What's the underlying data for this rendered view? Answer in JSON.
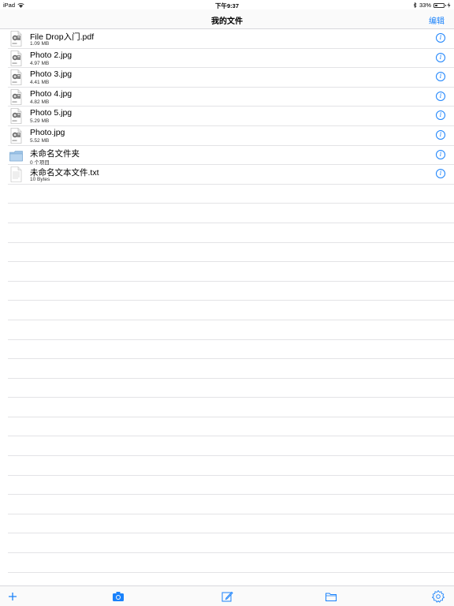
{
  "status_bar": {
    "device": "iPad",
    "time": "下午9:37",
    "battery_percent": "33%",
    "battery_level": 0.33
  },
  "nav": {
    "title": "我的文件",
    "edit_label": "编辑"
  },
  "files": [
    {
      "name": "File Drop入门.pdf",
      "detail": "1.09 MB",
      "kind": "pdf"
    },
    {
      "name": "Photo 2.jpg",
      "detail": "4.97 MB",
      "kind": "jpeg"
    },
    {
      "name": "Photo 3.jpg",
      "detail": "4.41 MB",
      "kind": "jpeg"
    },
    {
      "name": "Photo 4.jpg",
      "detail": "4.82 MB",
      "kind": "jpeg"
    },
    {
      "name": "Photo 5.jpg",
      "detail": "5.29 MB",
      "kind": "jpeg"
    },
    {
      "name": "Photo.jpg",
      "detail": "5.52 MB",
      "kind": "jpeg"
    },
    {
      "name": "未命名文件夹",
      "detail": "0 个项目",
      "kind": "folder"
    },
    {
      "name": "未命名文本文件.txt",
      "detail": "10 Bytes",
      "kind": "text"
    }
  ],
  "info_glyph": "i",
  "toolbar": {
    "items": [
      "add-icon",
      "camera-icon",
      "compose-icon",
      "folder-icon",
      "settings-gear-icon"
    ]
  },
  "colors": {
    "accent": "#1a82fb",
    "separator": "#e3e3e6"
  }
}
